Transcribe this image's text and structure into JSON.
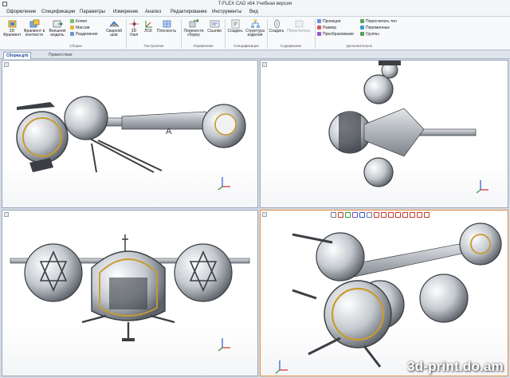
{
  "window": {
    "title": "T-FLEX CAD x64 Учебная версия"
  },
  "menu": {
    "tabs": [
      "Оформление",
      "Спецификации",
      "Параметры",
      "Измерение",
      "Анализ",
      "Редактирование",
      "Инструменты",
      "Вид"
    ]
  },
  "ribbon": {
    "buttons": {
      "fragment_3d": "3D Фрагмент",
      "fragment_context": "Фрагмент в контексте",
      "external_model": "Внешняя модель",
      "weld_seam": "Сварной шов",
      "node_3d": "3D Узел",
      "lsk": "ЛСК",
      "plane": "Плоскость",
      "move_assembly": "Перенести сборку",
      "links": "Ссылки",
      "create": "Создать",
      "structure": "Структура изделия",
      "create2": "Создать",
      "recalc": "Пересчитать"
    },
    "small": {
      "copy": "Копия",
      "array": "Массив",
      "split": "Разделение",
      "projection": "Проекция",
      "size": "Размер",
      "transform": "Преобразование",
      "recalc_bodies": "Пересчитать тел",
      "variables": "Переменные",
      "groups": "Группы"
    },
    "groups": {
      "assembly": "Сборка",
      "building": "Построения",
      "management": "Управление",
      "specification": "Спецификация",
      "contents": "Содержание",
      "extra": "Дополнительно"
    }
  },
  "documents": {
    "tabs": [
      "Сборка.grb",
      "Приветствие"
    ],
    "active": "Сборка.grb"
  },
  "viewports": {
    "selected": "bottom-right",
    "axes": {
      "x_color": "#d22a2a",
      "y_color": "#2a9b3a",
      "z_color": "#2a55d2"
    }
  },
  "watermark": "3d-print.do.am",
  "colors": {
    "accent": "#e58a3c",
    "tab_active": "#14469c",
    "model_body": "#a9b0b7",
    "model_dark": "#3b3f44",
    "model_gold": "#c99b2e"
  }
}
